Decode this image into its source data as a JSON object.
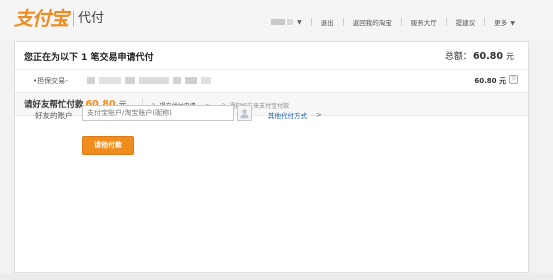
{
  "header": {
    "logo_text": "支付宝",
    "logo_sub": "代付",
    "nav": {
      "logout": "退出",
      "back_to_taobao": "返回我的淘宝",
      "service_hall": "服务大厅",
      "feedback": "提建议",
      "more": "更多",
      "caret": "▼"
    }
  },
  "order": {
    "title": "您正在为以下 1 笔交易申请代付",
    "total_label": "总额：",
    "total_amount": "60.80",
    "total_unit": "元",
    "item_label": "•担保交易-",
    "item_amount": "60.80 元",
    "expand_icon": "▽"
  },
  "steps": {
    "ask_label": "请好友帮忙付款",
    "ask_amount": "60.80",
    "ask_unit": "元",
    "step1": "1. 提交代付申请",
    "arrow": ">",
    "step2": "2. 通知好友来支付宝付款"
  },
  "form": {
    "account_label": "好友的账户",
    "account_placeholder": "支付宝账户/淘宝账户(昵称)",
    "account_value": "",
    "other_link": "其他代付方式",
    "other_chev": ">",
    "pay_button": "请他付款"
  },
  "colors": {
    "accent": "#f08c1e",
    "link": "#1a5ea8"
  }
}
